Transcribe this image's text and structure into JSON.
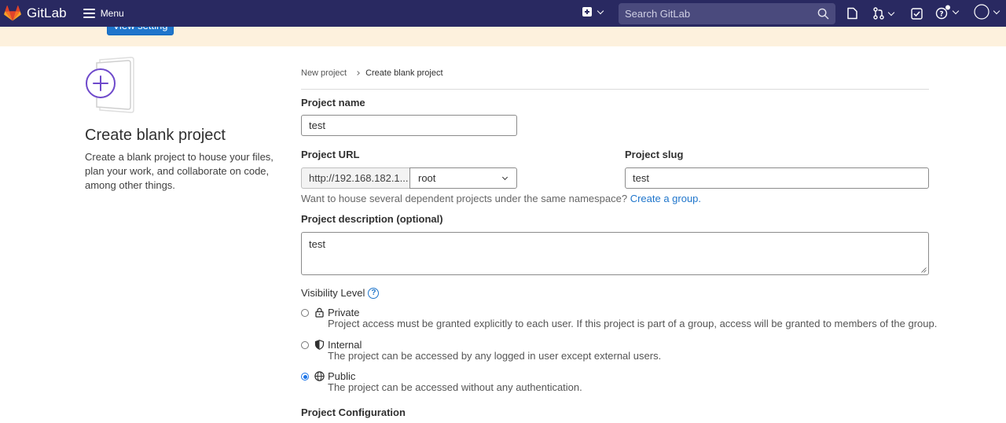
{
  "topbar": {
    "brand_name": "GitLab",
    "menu_label": "Menu",
    "search_placeholder": "Search GitLab",
    "colors": {
      "background": "#292961",
      "search_bg": "#4a4a7d"
    }
  },
  "banner": {
    "button_label": "View setting"
  },
  "intro": {
    "title": "Create blank project",
    "description": "Create a blank project to house your files, plan your work, and collaborate on code, among other things."
  },
  "breadcrumb": {
    "parent": "New project",
    "current": "Create blank project"
  },
  "form": {
    "project_name_label": "Project name",
    "project_name_value": "test",
    "project_url_label": "Project URL",
    "project_url_prefix": "http://192.168.182.1...",
    "namespace_value": "root",
    "project_slug_label": "Project slug",
    "project_slug_value": "test",
    "namespace_help": "Want to house several dependent projects under the same namespace?",
    "namespace_help_link": "Create a group.",
    "description_label": "Project description (optional)",
    "description_value": "test",
    "visibility_label": "Visibility Level",
    "visibility_options": [
      {
        "name": "Private",
        "description": "Project access must be granted explicitly to each user. If this project is part of a group, access will be granted to members of the group.",
        "icon": "lock-icon",
        "checked": false
      },
      {
        "name": "Internal",
        "description": "The project can be accessed by any logged in user except external users.",
        "icon": "shield-icon",
        "checked": false
      },
      {
        "name": "Public",
        "description": "The project can be accessed without any authentication.",
        "icon": "globe-icon",
        "checked": true
      }
    ],
    "configuration_label": "Project Configuration"
  }
}
